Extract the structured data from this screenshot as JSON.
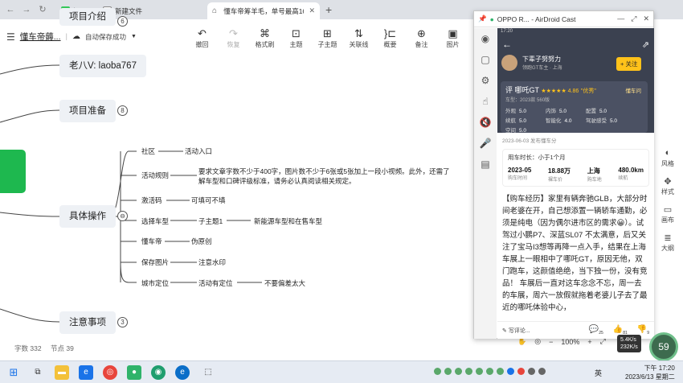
{
  "browser": {
    "tabs": [
      {
        "label": "知犀"
      },
      {
        "label": "新建文件"
      },
      {
        "label": "懂车帝筹羊毛，单号最高165+"
      }
    ]
  },
  "doc": {
    "title": "懂车帝薅...",
    "autosave": "自动保存成功"
  },
  "toolbar": [
    {
      "label": "撤回",
      "icon": "undo-icon"
    },
    {
      "label": "恢复",
      "icon": "redo-icon"
    },
    {
      "label": "格式刷",
      "icon": "format-brush-icon"
    },
    {
      "label": "主题",
      "icon": "theme-icon"
    },
    {
      "label": "子主题",
      "icon": "subtopic-icon"
    },
    {
      "label": "关联线",
      "icon": "relation-line-icon"
    },
    {
      "label": "概要",
      "icon": "summary-icon"
    },
    {
      "label": "备注",
      "icon": "note-icon"
    },
    {
      "label": "图片",
      "icon": "image-icon"
    }
  ],
  "mindmap": {
    "partial_top": "项目介绍",
    "partial_top_badge": "6",
    "contact": "老八V: laoba767",
    "prep": "项目准备",
    "prep_badge": "8",
    "ops": "具体操作",
    "notes": "注意事项",
    "notes_badge": "3",
    "branches": [
      {
        "label": "社区",
        "children": [
          "活动入口"
        ]
      },
      {
        "label": "活动规则",
        "children": [
          "要求文章字数不少于400字，图片数不少于6张或5张加上一段小视频。此外，还需了解车型和口碑评级标准，请务必认真阅读相关规定。"
        ]
      },
      {
        "label": "激活码",
        "children": [
          "可填可不填"
        ]
      },
      {
        "label": "选择车型",
        "children": [
          "子主题1",
          "新能源车型和在售车型"
        ]
      },
      {
        "label": "懂车帝",
        "children": [
          "伪原创"
        ]
      },
      {
        "label": "保存图片",
        "children": [
          "注意水印"
        ]
      },
      {
        "label": "城市定位",
        "children": [
          "活动有定位",
          "不要偏差太大"
        ]
      }
    ],
    "stats": {
      "words": "字数 332",
      "nodes": "节点 39"
    }
  },
  "right_panel": [
    {
      "label": "风格",
      "icon": "style-icon"
    },
    {
      "label": "样式",
      "icon": "format-icon"
    },
    {
      "label": "画布",
      "icon": "canvas-icon"
    },
    {
      "label": "大纲",
      "icon": "outline-icon"
    }
  ],
  "zoom": "100%",
  "gauge": "59",
  "speed": {
    "up": "5.4K/s",
    "down": "232K/s"
  },
  "cast": {
    "title": "OPPO R...  - AirDroid Cast",
    "status_time": "17:20",
    "author": "下辈子努努力",
    "author_sub": "领跑GT车主 · 上海",
    "follow": "+ 关注",
    "review_title": "评 哪吒GT",
    "review_stars": "★★★★★ 4.86",
    "review_grade": "\"优秀\"",
    "review_sub": "车型：2023款 560版",
    "dongchetong": "懂车问",
    "scores": [
      {
        "k": "外观",
        "v": "5.0"
      },
      {
        "k": "内饰",
        "v": "5.0"
      },
      {
        "k": "配置",
        "v": "5.0"
      },
      {
        "k": "空间",
        "v": "5.0"
      },
      {
        "k": "续航",
        "v": "5.0"
      },
      {
        "k": "智能化",
        "v": "4.0"
      },
      {
        "k": "驾驶感受",
        "v": "5.0"
      }
    ],
    "meta": "2023-06-03 发布懂车分",
    "usage_title": "用车时长：小于1个月",
    "usage": [
      {
        "v": "2023-05",
        "k": "购车时间"
      },
      {
        "v": "18.88万",
        "k": "裸车价"
      },
      {
        "v": "上海",
        "k": "购车地"
      },
      {
        "v": "480.0km",
        "k": "续航"
      }
    ],
    "body": "【购车经历】家里有辆奔驰GLB，大部分时间老婆在开，自己想添置一辆轿车通勤，必须是纯电（因为偶尔进市区的需求😀）。试驾过小鹏P7、深蓝SL07 不太满意，后又关注了宝马I3想等再降一点入手，结果在上海车展上一眼相中了哪吒GT，原因无他，双门跑车，这颜值绝绝，当下独一份，没有竞品！ 车展后一直对这车念念不忘，周一去的车展，周六一放假就拖着老婆儿子去了最近的哪吒体验中心，",
    "comment_placeholder": "写评论...",
    "counts": [
      "25",
      "81",
      "9"
    ]
  },
  "taskbar": {
    "ime": "英",
    "time": "下午 17:20",
    "date": "2023/6/13 星期二"
  }
}
